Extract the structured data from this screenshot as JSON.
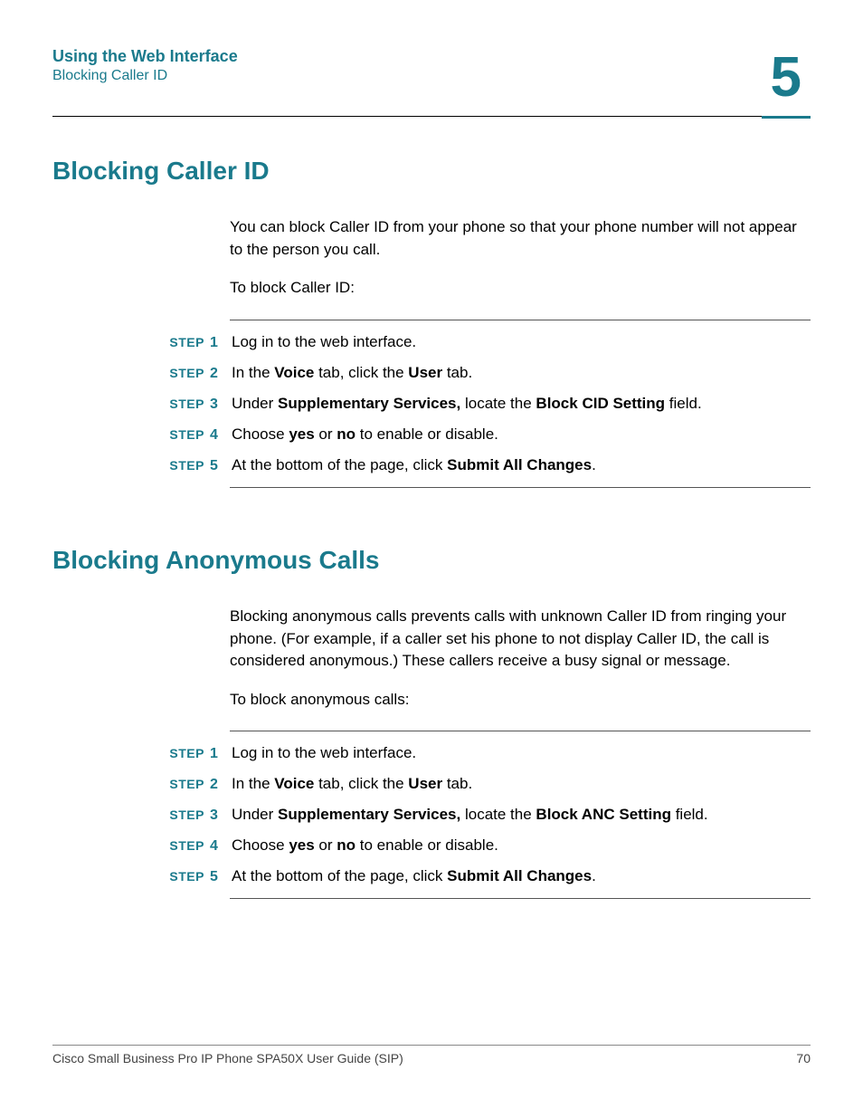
{
  "header": {
    "chapter_title": "Using the Web Interface",
    "breadcrumb": "Blocking Caller ID",
    "chapter_number": "5"
  },
  "section1": {
    "heading": "Blocking Caller ID",
    "intro": "You can block Caller ID from your phone so that your phone number will not appear to the person you call.",
    "lead": "To block Caller ID:",
    "step_label": "STEP",
    "steps": [
      {
        "n": "1",
        "pre": "Log in to the web interface."
      },
      {
        "n": "2",
        "pre": "In the ",
        "b1": "Voice",
        "mid1": " tab, click the ",
        "b2": "User",
        "post": " tab."
      },
      {
        "n": "3",
        "pre": "Under ",
        "b1": "Supplementary Services,",
        "mid1": " locate the ",
        "b2": "Block CID Setting",
        "post": " field."
      },
      {
        "n": "4",
        "pre": "Choose ",
        "b1": "yes",
        "mid1": " or ",
        "b2": "no",
        "post": " to enable or disable."
      },
      {
        "n": "5",
        "pre": "At the bottom of the page, click ",
        "b1": "Submit All Changes",
        "post": "."
      }
    ]
  },
  "section2": {
    "heading": "Blocking Anonymous Calls",
    "intro": "Blocking anonymous calls prevents calls with unknown Caller ID from ringing your phone. (For example, if a caller set his phone to not display Caller ID, the call is considered anonymous.) These callers receive a busy signal or message.",
    "lead": "To block anonymous calls:",
    "step_label": "STEP",
    "steps": [
      {
        "n": "1",
        "pre": "Log in to the web interface."
      },
      {
        "n": "2",
        "pre": "In the ",
        "b1": "Voice",
        "mid1": " tab, click the ",
        "b2": "User",
        "post": " tab."
      },
      {
        "n": "3",
        "pre": "Under ",
        "b1": "Supplementary Services,",
        "mid1": " locate the ",
        "b2": "Block ANC Setting",
        "post": " field."
      },
      {
        "n": "4",
        "pre": "Choose ",
        "b1": "yes",
        "mid1": " or ",
        "b2": "no",
        "post": " to enable or disable."
      },
      {
        "n": "5",
        "pre": "At the bottom of the page, click ",
        "b1": "Submit All Changes",
        "post": "."
      }
    ]
  },
  "footer": {
    "doc_title": "Cisco Small Business Pro IP Phone SPA50X User Guide (SIP)",
    "page_number": "70"
  }
}
